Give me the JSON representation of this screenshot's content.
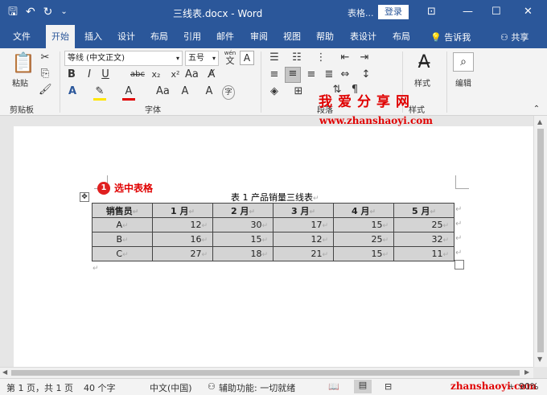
{
  "titlebar": {
    "doc_title": "三线表.docx  -  Word",
    "context_label": "表格...",
    "login_label": "登录",
    "icons": [
      "save-icon",
      "undo-icon",
      "redo-icon",
      "customize-icon"
    ]
  },
  "tabs": [
    {
      "label": "文件",
      "active": false
    },
    {
      "label": "开始",
      "active": true
    },
    {
      "label": "插入",
      "active": false
    },
    {
      "label": "设计",
      "active": false
    },
    {
      "label": "布局",
      "active": false
    },
    {
      "label": "引用",
      "active": false
    },
    {
      "label": "邮件",
      "active": false
    },
    {
      "label": "审阅",
      "active": false
    },
    {
      "label": "视图",
      "active": false
    },
    {
      "label": "帮助",
      "active": false
    },
    {
      "label": "表设计",
      "active": false
    },
    {
      "label": "布局",
      "active": false
    }
  ],
  "tell_me": "告诉我",
  "share": "共享",
  "ribbon": {
    "clipboard": {
      "paste_label": "粘贴",
      "group_label": "剪贴板"
    },
    "font": {
      "font_name": "等线 (中文正文)",
      "font_size": "五号",
      "wen_label": "wén",
      "wen_char": "文",
      "group_label": "字体",
      "bold": "B",
      "italic": "I",
      "underline": "U",
      "strike": "abc",
      "subscript": "x₂",
      "superscript": "x²",
      "highlight": "A",
      "font_color": "A",
      "grow": "Aa",
      "char_shade": "A",
      "enclose": "字"
    },
    "paragraph": {
      "group_label": "段落"
    },
    "styles": {
      "label": "样式",
      "group_label": "样式"
    },
    "editing": {
      "label": "编辑"
    }
  },
  "watermark": {
    "chinese": "我爱分享网",
    "url": "www.zhanshaoyi.com",
    "status_url": "zhanshaoyi.com"
  },
  "document": {
    "callout_number": "1",
    "callout_text": "选中表格",
    "caption": "表 1  产品销量三线表",
    "paragraph_mark": "↵",
    "table": {
      "headers": [
        "销售员",
        "1 月",
        "2 月",
        "3 月",
        "4 月",
        "5 月"
      ],
      "rows": [
        [
          "A",
          "12",
          "30",
          "17",
          "15",
          "25"
        ],
        [
          "B",
          "16",
          "15",
          "12",
          "25",
          "32"
        ],
        [
          "C",
          "27",
          "18",
          "21",
          "15",
          "11"
        ]
      ]
    }
  },
  "status": {
    "page": "第 1 页，共 1 页",
    "words": "40 个字",
    "language": "中文(中国)",
    "accessibility": "辅助功能: 一切就绪",
    "zoom": "90%"
  }
}
